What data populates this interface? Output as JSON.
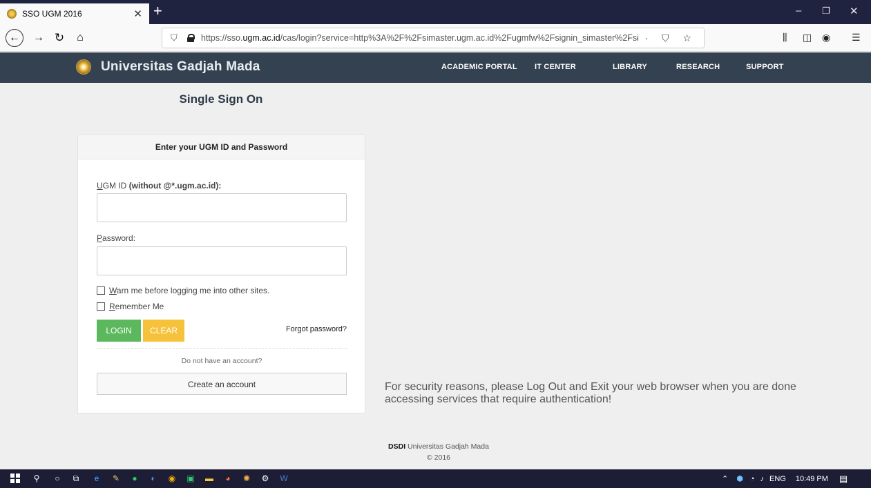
{
  "browser": {
    "tab_title": "SSO UGM 2016",
    "url_prefix": "https://sso.",
    "url_domain": "ugm.ac.id",
    "url_rest": "/cas/login?service=http%3A%2F%2Fsimaster.ugm.ac.id%2Fugmfw%2Fsignin_simaster%2Fsi",
    "page_actions": "··· ⛉ ☆"
  },
  "site": {
    "brand": "Universitas Gadjah Mada",
    "menu": [
      "ACADEMIC PORTAL",
      "IT CENTER",
      "LIBRARY",
      "RESEARCH",
      "SUPPORT"
    ]
  },
  "main": {
    "title": "Single Sign On",
    "card_heading": "Enter your UGM ID and Password",
    "ugm_id_label_first": "U",
    "ugm_id_label_rest": "GM ID ",
    "ugm_id_label_bold": "(without @*.ugm.ac.id):",
    "password_label_first": "P",
    "password_label_rest": "assword:",
    "warn_first": "W",
    "warn_rest": "arn me before logging me into other sites.",
    "remember_first": "R",
    "remember_rest": "emember Me",
    "login_label": "LOGIN",
    "clear_label": "CLEAR",
    "forgot_label": "Forgot password?",
    "no_account": "Do not have an account?",
    "create_label": "Create an account",
    "security_note": "For security reasons, please Log Out and Exit your web browser when you are done accessing services that require authentication!"
  },
  "footer": {
    "org_bold": "DSDI",
    "org_rest": " Universitas Gadjah Mada",
    "copyright": "© 2016"
  },
  "taskbar": {
    "lang": "ENG",
    "time": "10:49 PM"
  }
}
